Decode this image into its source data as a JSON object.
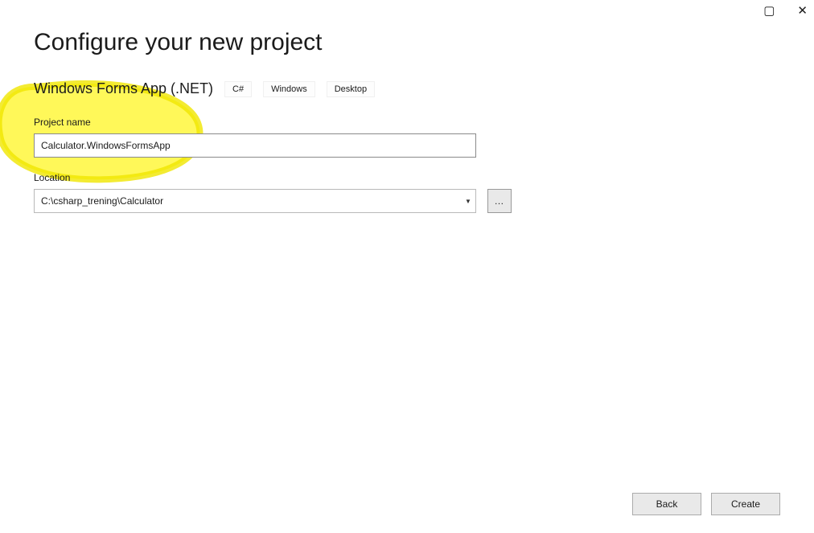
{
  "window": {
    "maximize_glyph": "▢",
    "close_glyph": "✕"
  },
  "page": {
    "title": "Configure your new project",
    "template_name": "Windows Forms App (.NET)",
    "tags": [
      "C#",
      "Windows",
      "Desktop"
    ]
  },
  "form": {
    "project_name_label": "Project name",
    "project_name_value": "Calculator.WindowsFormsApp",
    "location_label": "Location",
    "location_value": "C:\\csharp_trening\\Calculator",
    "browse_label": "…"
  },
  "buttons": {
    "back": "Back",
    "create": "Create"
  }
}
